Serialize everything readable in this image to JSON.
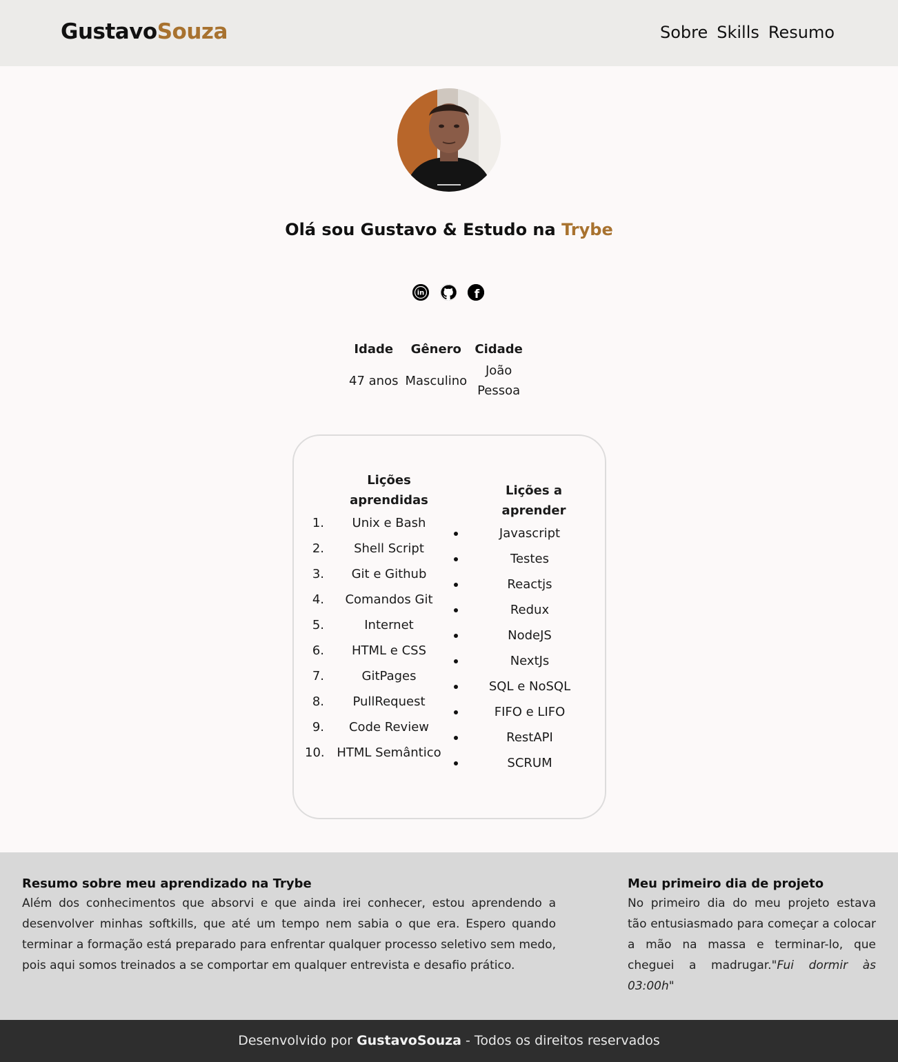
{
  "header": {
    "logo_first": "Gustavo",
    "logo_second": "Souza",
    "nav": [
      "Sobre",
      "Skills",
      "Resumo"
    ]
  },
  "hero": {
    "greeting_prefix": "Olá sou Gustavo & Estudo na ",
    "greeting_brand": "Trybe",
    "socials": [
      {
        "name": "linkedin-icon",
        "glyph": "in"
      },
      {
        "name": "github-icon"
      },
      {
        "name": "facebook-icon",
        "glyph": "f"
      }
    ]
  },
  "info": {
    "headers": [
      "Idade",
      "Gênero",
      "Cidade"
    ],
    "values": [
      "47 anos",
      "Masculino",
      "João Pessoa"
    ]
  },
  "lessons": {
    "learned_title": "Lições aprendidas",
    "learned": [
      "Unix e Bash",
      "Shell Script",
      "Git e Github",
      "Comandos Git",
      "Internet",
      "HTML e CSS",
      "GitPages",
      "PullRequest",
      "Code Review",
      "HTML Semântico"
    ],
    "to_learn_title": "Lições a aprender",
    "to_learn": [
      "Javascript",
      "Testes",
      "Reactjs",
      "Redux",
      "NodeJS",
      "NextJs",
      "SQL e NoSQL",
      "FIFO e LIFO",
      "RestAPI",
      "SCRUM"
    ]
  },
  "summary": {
    "left_title": "Resumo sobre meu aprendizado na Trybe",
    "left_text": "Além dos conhecimentos que absorvi e que ainda irei conhecer, estou aprendendo a desenvolver minhas softkills, que até um tempo nem sabia o que era. Espero quando terminar a formação está preparado para enfrentar qualquer processo seletivo sem medo, pois aqui somos treinados a se comportar em qualquer entrevista e desafio prático.",
    "right_title": "Meu primeiro dia de projeto",
    "right_text": "No primeiro dia do meu projeto estava tão entusiasmado para começar a colocar a mão na massa e terminar-lo, que cheguei a madrugar.",
    "right_quote": "\"Fui dormir às 03:00h\""
  },
  "footer": {
    "prefix": "Desenvolvido por ",
    "name": "GustavoSouza",
    "suffix": " - Todos os direitos reservados"
  },
  "colors": {
    "accent": "#a8722f",
    "header_bg": "#ecebe9",
    "summary_bg": "#d8d8d8",
    "footer_bg": "#2e2e2e"
  }
}
